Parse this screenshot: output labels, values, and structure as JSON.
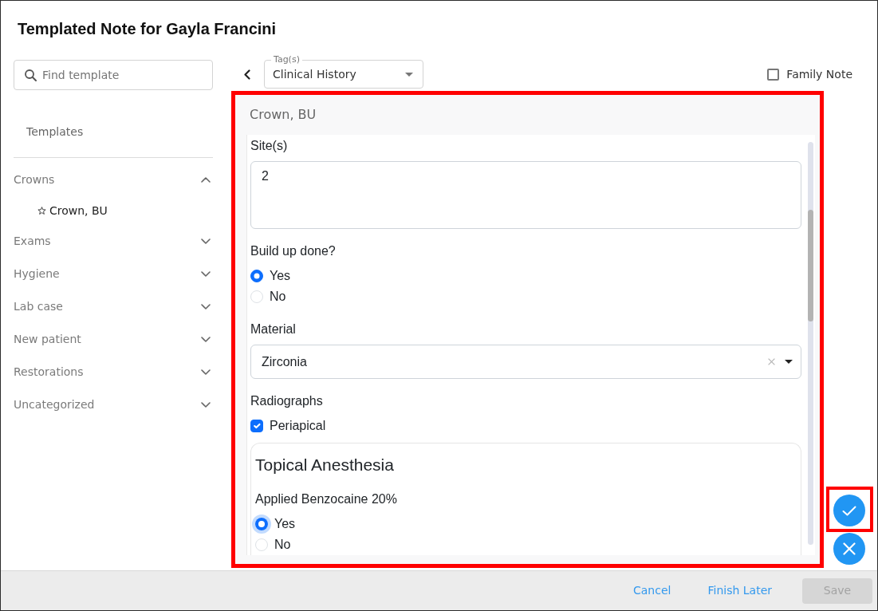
{
  "dialog": {
    "title": "Templated Note for Gayla Francini"
  },
  "sidebar": {
    "search": {
      "placeholder": "Find template"
    },
    "heading": "Templates",
    "categories": [
      {
        "label": "Crowns",
        "expanded": true,
        "children": [
          {
            "label": "Crown, BU",
            "starred": false
          }
        ]
      },
      {
        "label": "Exams",
        "expanded": false
      },
      {
        "label": "Hygiene",
        "expanded": false
      },
      {
        "label": "Lab case",
        "expanded": false
      },
      {
        "label": "New patient",
        "expanded": false
      },
      {
        "label": "Restorations",
        "expanded": false
      },
      {
        "label": "Uncategorized",
        "expanded": false
      }
    ]
  },
  "toolbar": {
    "tags": {
      "label": "Tag(s)",
      "value": "Clinical History"
    },
    "family_note": {
      "label": "Family Note",
      "checked": false
    }
  },
  "form": {
    "title": "Crown, BU",
    "highlighted": true,
    "fields": [
      {
        "kind": "textarea",
        "label": "Site(s)",
        "value": "2"
      },
      {
        "kind": "radio",
        "label": "Build up done?",
        "options": [
          {
            "label": "Yes",
            "selected": true,
            "focused": false
          },
          {
            "label": "No",
            "selected": false,
            "focused": false
          }
        ]
      },
      {
        "kind": "select",
        "label": "Material",
        "value": "Zirconia"
      },
      {
        "kind": "checkbox",
        "label": "Radiographs",
        "options": [
          {
            "label": "Periapical",
            "checked": true
          }
        ]
      },
      {
        "kind": "section",
        "title": "Topical Anesthesia",
        "fields": [
          {
            "kind": "radio",
            "label": "Applied Benzocaine 20%",
            "options": [
              {
                "label": "Yes",
                "selected": true,
                "focused": true
              },
              {
                "label": "No",
                "selected": false,
                "focused": false
              }
            ]
          }
        ]
      }
    ]
  },
  "side_actions": [
    {
      "kind": "confirm",
      "highlighted": true
    },
    {
      "kind": "dismiss",
      "highlighted": false
    }
  ],
  "footer": {
    "buttons": [
      {
        "kind": "link",
        "label": "Cancel",
        "disabled": false
      },
      {
        "kind": "link",
        "label": "Finish Later",
        "disabled": false
      },
      {
        "kind": "primary",
        "label": "Save",
        "disabled": true
      }
    ]
  }
}
